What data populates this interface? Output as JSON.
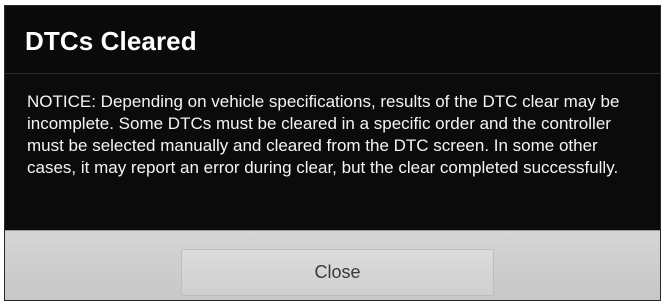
{
  "dialog": {
    "title": "DTCs Cleared",
    "message": "NOTICE: Depending on vehicle specifications, results of the DTC clear may be incomplete. Some DTCs must be cleared in a specific order and the controller must be selected manually and cleared from the DTC screen. In some other cases, it may report an error during clear, but the clear completed successfully.",
    "buttons": {
      "close_label": "Close"
    }
  },
  "colors": {
    "dialog_background": "#0b0b0b",
    "text": "#ffffff",
    "button_bar": "#cfcfcf",
    "button_text": "#3a3a3a"
  }
}
